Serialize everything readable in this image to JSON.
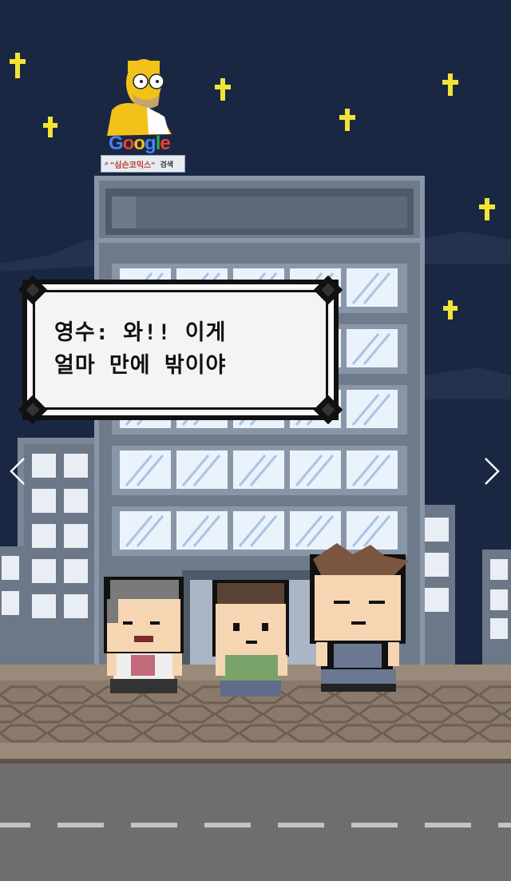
{
  "dialog": {
    "line1": "영수: 와!! 이게",
    "line2": "얼마 만에 밖이야"
  },
  "badge": {
    "brand": "Google",
    "query": "\"심슨코믹스\"",
    "search_label": "검색"
  },
  "nav": {
    "prev_icon": "chevron-left-icon",
    "next_icon": "chevron-right-icon"
  },
  "colors": {
    "sky": "#1a2742",
    "building": "#6f7b8b",
    "star": "#f2e437",
    "sidewalk": "#8a7a6c",
    "road": "#6e6e6e"
  }
}
